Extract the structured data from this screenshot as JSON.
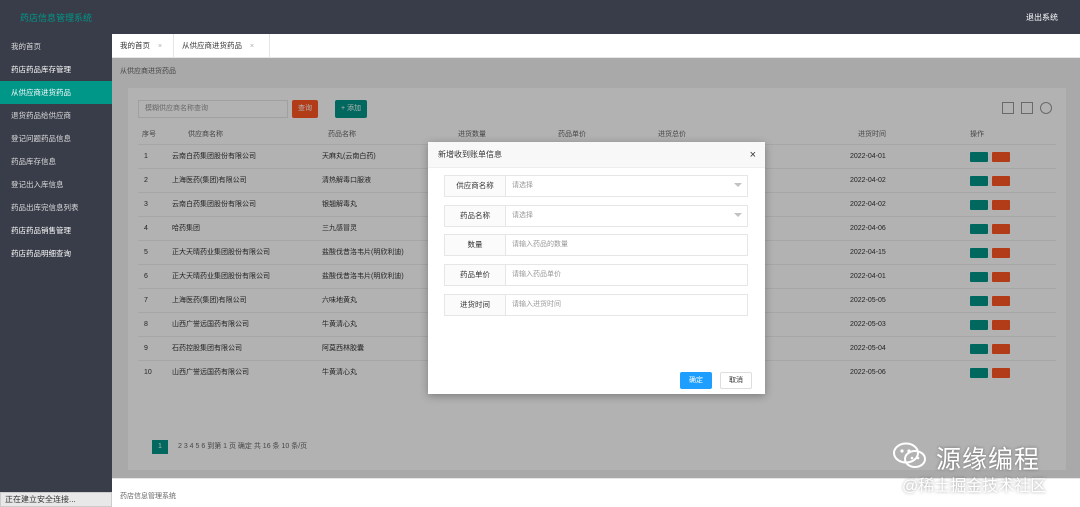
{
  "header": {
    "title": "药店信息管理系统",
    "logout": "退出系统"
  },
  "sidebar": {
    "items": [
      {
        "label": "我的首页",
        "state": "normal"
      },
      {
        "label": "药店药品库存管理",
        "state": "group"
      },
      {
        "label": "从供应商进货药品",
        "state": "active"
      },
      {
        "label": "退货药品给供应商",
        "state": "normal"
      },
      {
        "label": "登记问题药品信息",
        "state": "normal"
      },
      {
        "label": "药品库存信息",
        "state": "normal"
      },
      {
        "label": "登记出入库信息",
        "state": "normal"
      },
      {
        "label": "药品出库完信息列表",
        "state": "normal"
      },
      {
        "label": "药店药品销售管理",
        "state": "group"
      },
      {
        "label": "药店药品明细查询",
        "state": "group"
      }
    ]
  },
  "tabs": [
    {
      "label": "我的首页",
      "close": "×"
    },
    {
      "label": "从供应商进货药品",
      "close": "×"
    }
  ],
  "page": {
    "breadcrumb": "从供应商进货药品",
    "search_placeholder": "模糊供应商名称查询",
    "search_button": "查询",
    "add_button": "+ 添加",
    "columns": [
      "序号",
      "供应商名称",
      "药品名称",
      "进货数量",
      "药品单价",
      "进货总价",
      "进货时间",
      "操作"
    ],
    "rows": [
      {
        "no": "1",
        "supplier": "云南白药集团股份有限公司",
        "drug": "天麻丸(云南白药)",
        "date": "2022-04-01"
      },
      {
        "no": "2",
        "supplier": "上海医药(集团)有限公司",
        "drug": "清热解毒口服液",
        "date": "2022-04-02"
      },
      {
        "no": "3",
        "supplier": "云南白药集团股份有限公司",
        "drug": "银翘解毒丸",
        "date": "2022-04-02"
      },
      {
        "no": "4",
        "supplier": "哈药集团",
        "drug": "三九感冒灵",
        "date": "2022-04-06"
      },
      {
        "no": "5",
        "supplier": "正大天晴药业集团股份有限公司",
        "drug": "盐酸伐昔洛韦片(明欣利迪)",
        "date": "2022-04-15"
      },
      {
        "no": "6",
        "supplier": "正大天晴药业集团股份有限公司",
        "drug": "盐酸伐昔洛韦片(明欣利迪)",
        "date": "2022-04-01"
      },
      {
        "no": "7",
        "supplier": "上海医药(集团)有限公司",
        "drug": "六味地黄丸",
        "date": "2022-05-05"
      },
      {
        "no": "8",
        "supplier": "山西广誉远国药有限公司",
        "drug": "牛黄清心丸",
        "date": "2022-05-03"
      },
      {
        "no": "9",
        "supplier": "石药控股集团有限公司",
        "drug": "阿莫西林胶囊",
        "date": "2022-05-04"
      },
      {
        "no": "10",
        "supplier": "山西广誉远国药有限公司",
        "drug": "牛黄清心丸",
        "date": "2022-05-06"
      }
    ],
    "pager": {
      "current": "1",
      "rest": "2   3   4   5   6   到第 1 页   确定   共 16 条   10 条/页"
    },
    "footer": "药店信息管理系统"
  },
  "modal": {
    "title": "新增收到账单信息",
    "close": "×",
    "fields": [
      {
        "label": "供应商名称",
        "placeholder": "请选择",
        "type": "select"
      },
      {
        "label": "药品名称",
        "placeholder": "请选择",
        "type": "select"
      },
      {
        "label": "数量",
        "placeholder": "请输入药品的数量",
        "type": "input"
      },
      {
        "label": "药品单价",
        "placeholder": "请输入药品单价",
        "type": "input"
      },
      {
        "label": "进货时间",
        "placeholder": "请输入进货时间",
        "type": "input"
      }
    ],
    "ok": "确定",
    "cancel": "取消"
  },
  "browser_status": "正在建立安全连接...",
  "watermark": {
    "brand": "源缘编程",
    "sub": "@稀土掘金技术社区"
  },
  "colors": {
    "primary": "#009688",
    "danger": "#ff5722",
    "header_bg": "#393d49",
    "ok_button": "#1e9fff"
  }
}
